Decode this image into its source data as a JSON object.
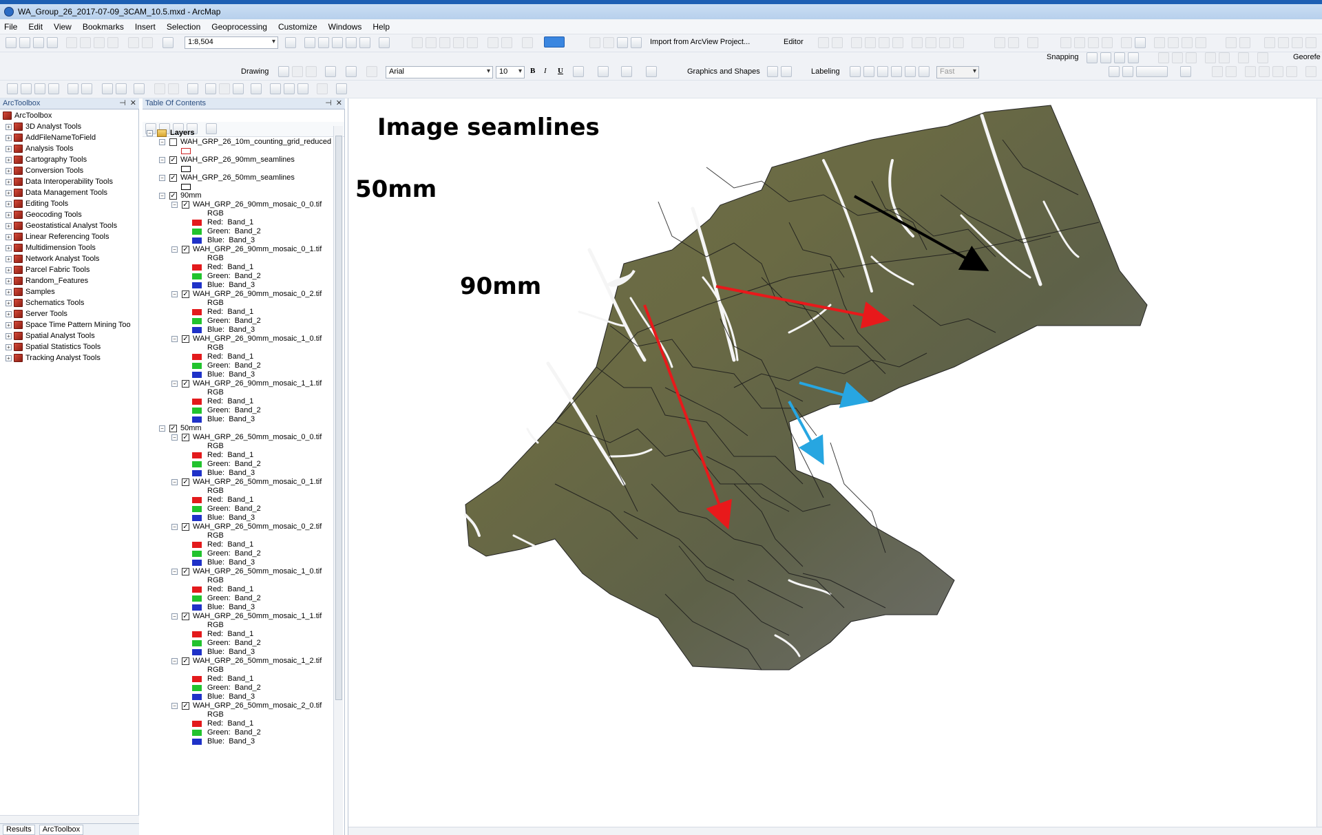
{
  "window": {
    "title": "WA_Group_26_2017-07-09_3CAM_10.5.mxd - ArcMap"
  },
  "menu": [
    "File",
    "Edit",
    "View",
    "Bookmarks",
    "Insert",
    "Selection",
    "Geoprocessing",
    "Customize",
    "Windows",
    "Help"
  ],
  "toolbar": {
    "scale": "1:8,504",
    "import_label": "Import from ArcView Project...",
    "editor_label": "Editor",
    "georef_label": "Georefe",
    "snapping_label": "Snapping",
    "drawing_label": "Drawing",
    "font_name": "Arial",
    "font_size": "10",
    "bold": "B",
    "italic": "I",
    "underline": "U",
    "graphics_label": "Graphics and Shapes",
    "labeling_label": "Labeling",
    "label_speed": "Fast"
  },
  "toolbox": {
    "header": "ArcToolbox",
    "root": "ArcToolbox",
    "items": [
      "3D Analyst Tools",
      "AddFileNameToField",
      "Analysis Tools",
      "Cartography Tools",
      "Conversion Tools",
      "Data Interoperability Tools",
      "Data Management Tools",
      "Editing Tools",
      "Geocoding Tools",
      "Geostatistical Analyst Tools",
      "Linear Referencing Tools",
      "Multidimension Tools",
      "Network Analyst Tools",
      "Parcel Fabric Tools",
      "Random_Features",
      "Samples",
      "Schematics Tools",
      "Server Tools",
      "Space Time Pattern Mining Too",
      "Spatial Analyst Tools",
      "Spatial Statistics Tools",
      "Tracking Analyst Tools"
    ]
  },
  "toc": {
    "header": "Table Of Contents",
    "root": "Layers",
    "top_layers": [
      {
        "name": "WAH_GRP_26_10m_counting_grid_reduced",
        "checked": false,
        "swatch": "#cc2222"
      },
      {
        "name": "WAH_GRP_26_90mm_seamlines",
        "checked": true,
        "swatch": "#000000"
      },
      {
        "name": "WAH_GRP_26_50mm_seamlines",
        "checked": true,
        "swatch": "#000000"
      }
    ],
    "groups": [
      {
        "name": "90mm",
        "rasters": [
          "WAH_GRP_26_90mm_mosaic_0_0.tif",
          "WAH_GRP_26_90mm_mosaic_0_1.tif",
          "WAH_GRP_26_90mm_mosaic_0_2.tif",
          "WAH_GRP_26_90mm_mosaic_1_0.tif",
          "WAH_GRP_26_90mm_mosaic_1_1.tif"
        ]
      },
      {
        "name": "50mm",
        "rasters": [
          "WAH_GRP_26_50mm_mosaic_0_0.tif",
          "WAH_GRP_26_50mm_mosaic_0_1.tif",
          "WAH_GRP_26_50mm_mosaic_0_2.tif",
          "WAH_GRP_26_50mm_mosaic_1_0.tif",
          "WAH_GRP_26_50mm_mosaic_1_1.tif",
          "WAH_GRP_26_50mm_mosaic_1_2.tif",
          "WAH_GRP_26_50mm_mosaic_2_0.tif"
        ]
      }
    ],
    "rgb_label": "RGB",
    "bands": [
      {
        "label": "Red:",
        "band": "Band_1",
        "color": "#e31a1c"
      },
      {
        "label": "Green:",
        "band": "Band_2",
        "color": "#22c32e"
      },
      {
        "label": "Blue:",
        "band": "Band_3",
        "color": "#1f32c8"
      }
    ]
  },
  "bottom_tabs": [
    "Results",
    "ArcToolbox"
  ],
  "annotations": {
    "seamlines": "Image seamlines",
    "mm50": "50mm",
    "mm90": "90mm",
    "colors": {
      "seamlines": "#000000",
      "mm50": "#e8191b",
      "mm90": "#27a6e1"
    }
  }
}
